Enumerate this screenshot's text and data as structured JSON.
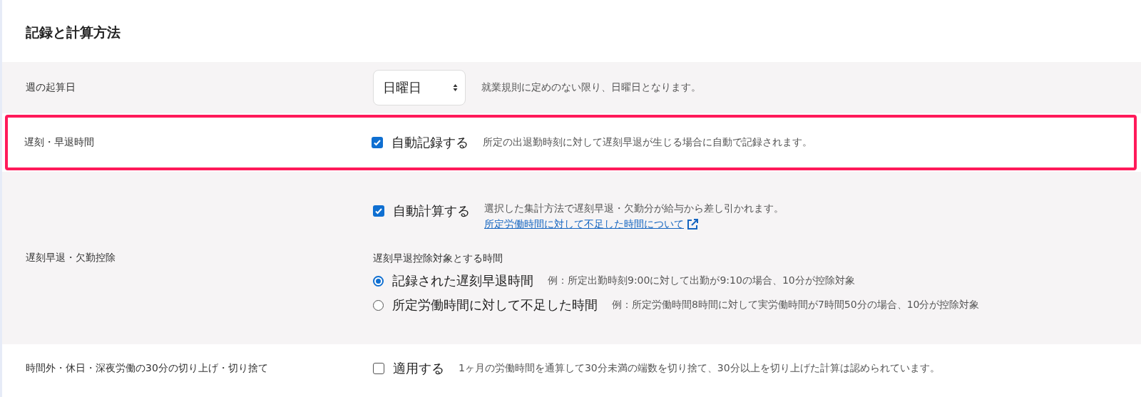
{
  "title": "記録と計算方法",
  "rows": [
    {
      "kind": "select",
      "label": "週の起算日",
      "select": {
        "value": "日曜日"
      },
      "note": "就業規則に定めのない限り、日曜日となります。",
      "highlighted": false
    },
    {
      "kind": "checkbox",
      "label": "遅刻・早退時間",
      "checkbox": {
        "label": "自動記録する",
        "checked": true
      },
      "note": "所定の出退勤時刻に対して遅刻早退が生じる場合に自動で記録されます。",
      "highlighted": true
    },
    {
      "kind": "deduction",
      "label": "遅刻早退・欠勤控除",
      "checkbox": {
        "label": "自動計算する",
        "checked": true
      },
      "note": "選択した集計方法で遅刻早退・欠勤分が給与から差し引かれます。",
      "link": "所定労働時間に対して不足した時間について",
      "sublabel": "遅刻早退控除対象とする時間",
      "radios": [
        {
          "label": "記録された遅刻早退時間",
          "selected": true,
          "example": "例：所定出勤時刻9:00に対して出勤が9:10の場合、10分が控除対象"
        },
        {
          "label": "所定労働時間に対して不足した時間",
          "selected": false,
          "example": "例：所定労働時間8時間に対して実労働時間が7時間50分の場合、10分が控除対象"
        }
      ],
      "highlighted": false
    },
    {
      "kind": "checkbox",
      "label": "時間外・休日・深夜労働の30分の切り上げ・切り捨て",
      "checkbox": {
        "label": "適用する",
        "checked": false
      },
      "note": "1ヶ月の労働時間を通算して30分未満の端数を切り捨て、30分以上を切り上げた計算は認められています。",
      "highlighted": false
    }
  ]
}
